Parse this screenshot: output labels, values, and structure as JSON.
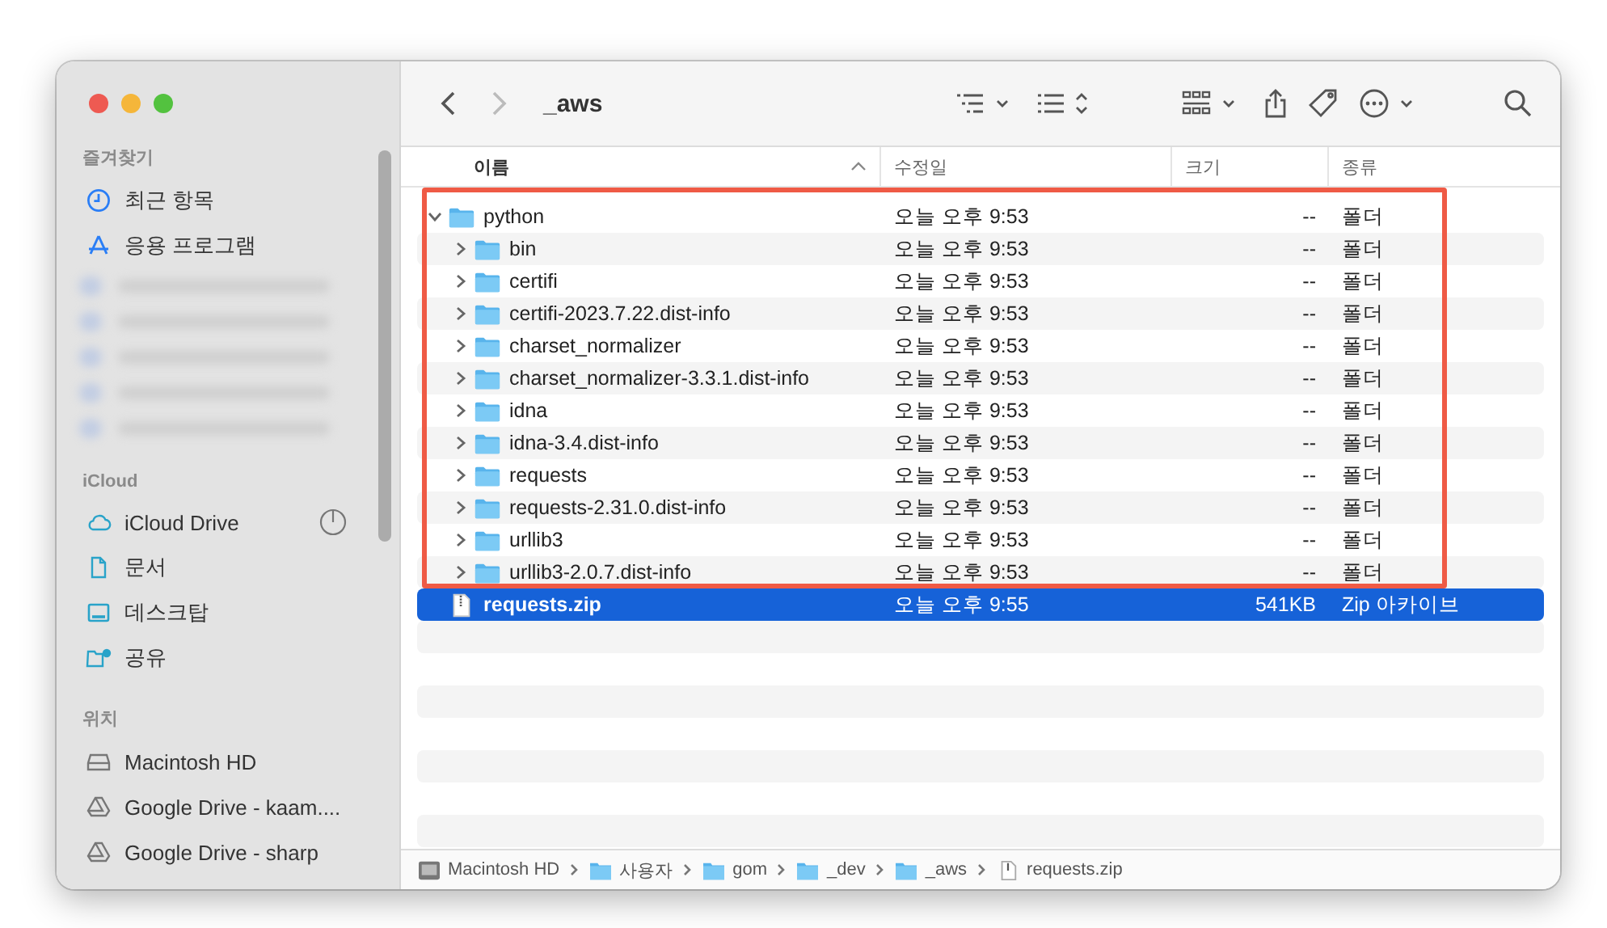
{
  "window": {
    "title": "_aws"
  },
  "sidebar": {
    "sections": [
      {
        "heading": "즐겨찾기",
        "items": [
          {
            "kind": "clock",
            "label": "최근 항목"
          },
          {
            "kind": "apps",
            "label": "응용 프로그램"
          },
          {
            "kind": "blurred"
          },
          {
            "kind": "blurred"
          },
          {
            "kind": "blurred"
          },
          {
            "kind": "blurred"
          },
          {
            "kind": "blurred"
          }
        ]
      },
      {
        "heading": "iCloud",
        "items": [
          {
            "kind": "cloud",
            "label": "iCloud Drive",
            "syncing": true
          },
          {
            "kind": "doc",
            "label": "문서"
          },
          {
            "kind": "desktop",
            "label": "데스크탑"
          },
          {
            "kind": "shared",
            "label": "공유"
          }
        ]
      },
      {
        "heading": "위치",
        "items": [
          {
            "kind": "disk",
            "label": "Macintosh HD"
          },
          {
            "kind": "gdrive",
            "label": "Google Drive - kaam...."
          },
          {
            "kind": "gdrive",
            "label": "Google Drive - sharp"
          }
        ]
      }
    ]
  },
  "columns": [
    {
      "label": "이름",
      "sorted": true
    },
    {
      "label": "수정일",
      "sorted": false
    },
    {
      "label": "크기",
      "sorted": false
    },
    {
      "label": "종류",
      "sorted": false
    }
  ],
  "files": [
    {
      "is_folder": true,
      "name": "python",
      "modified": "오늘 오후 9:53",
      "size": "--",
      "kind": "폴더",
      "expanded": true,
      "selected": false,
      "children": [
        {
          "is_folder": true,
          "name": "bin",
          "modified": "오늘 오후 9:53",
          "size": "--",
          "kind": "폴더",
          "expanded": false,
          "selected": false
        },
        {
          "is_folder": true,
          "name": "certifi",
          "modified": "오늘 오후 9:53",
          "size": "--",
          "kind": "폴더",
          "expanded": false,
          "selected": false
        },
        {
          "is_folder": true,
          "name": "certifi-2023.7.22.dist-info",
          "modified": "오늘 오후 9:53",
          "size": "--",
          "kind": "폴더",
          "expanded": false,
          "selected": false
        },
        {
          "is_folder": true,
          "name": "charset_normalizer",
          "modified": "오늘 오후 9:53",
          "size": "--",
          "kind": "폴더",
          "expanded": false,
          "selected": false
        },
        {
          "is_folder": true,
          "name": "charset_normalizer-3.3.1.dist-info",
          "modified": "오늘 오후 9:53",
          "size": "--",
          "kind": "폴더",
          "expanded": false,
          "selected": false
        },
        {
          "is_folder": true,
          "name": "idna",
          "modified": "오늘 오후 9:53",
          "size": "--",
          "kind": "폴더",
          "expanded": false,
          "selected": false
        },
        {
          "is_folder": true,
          "name": "idna-3.4.dist-info",
          "modified": "오늘 오후 9:53",
          "size": "--",
          "kind": "폴더",
          "expanded": false,
          "selected": false
        },
        {
          "is_folder": true,
          "name": "requests",
          "modified": "오늘 오후 9:53",
          "size": "--",
          "kind": "폴더",
          "expanded": false,
          "selected": false
        },
        {
          "is_folder": true,
          "name": "requests-2.31.0.dist-info",
          "modified": "오늘 오후 9:53",
          "size": "--",
          "kind": "폴더",
          "expanded": false,
          "selected": false
        },
        {
          "is_folder": true,
          "name": "urllib3",
          "modified": "오늘 오후 9:53",
          "size": "--",
          "kind": "폴더",
          "expanded": false,
          "selected": false
        },
        {
          "is_folder": true,
          "name": "urllib3-2.0.7.dist-info",
          "modified": "오늘 오후 9:53",
          "size": "--",
          "kind": "폴더",
          "expanded": false,
          "selected": false
        }
      ]
    },
    {
      "is_folder": false,
      "name": "requests.zip",
      "modified": "오늘 오후 9:55",
      "size": "541KB",
      "kind": "Zip 아카이브",
      "selected": true
    }
  ],
  "path_bar": [
    {
      "kind": "disk",
      "label": "Macintosh HD"
    },
    {
      "kind": "folder",
      "label": "사용자"
    },
    {
      "kind": "folder",
      "label": "gom"
    },
    {
      "kind": "folder",
      "label": "_dev"
    },
    {
      "kind": "folder",
      "label": "_aws"
    },
    {
      "kind": "file",
      "label": "requests.zip"
    }
  ]
}
